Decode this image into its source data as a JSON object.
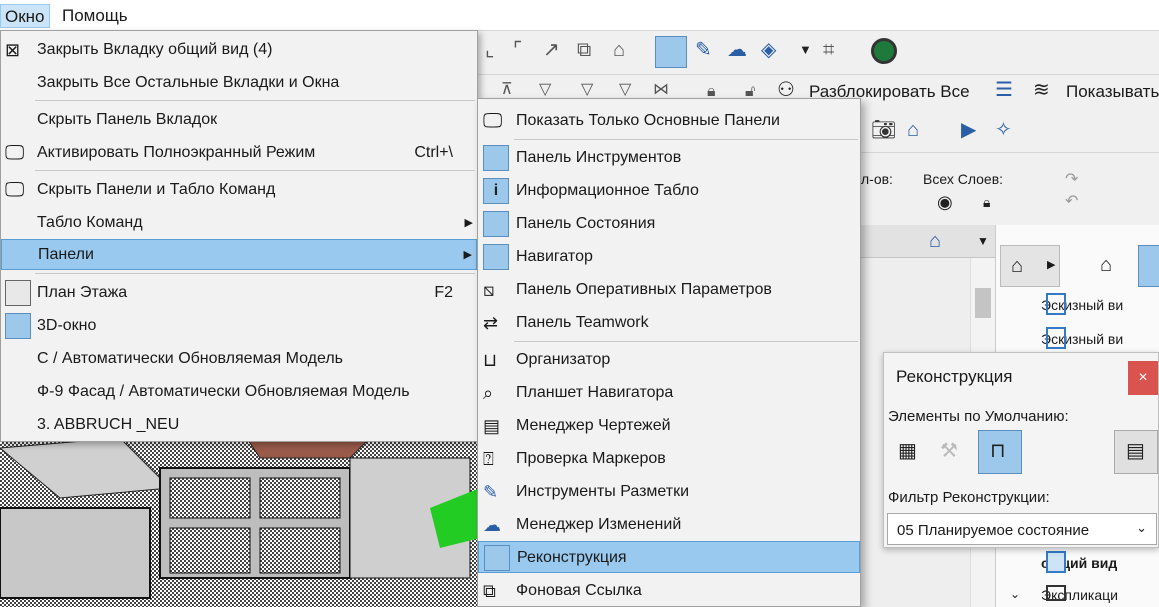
{
  "menubar": {
    "window_label": "Окно",
    "help_label": "Помощь"
  },
  "toolbar": {
    "unlock_all_label": "Разблокировать Все",
    "show_label": "Показывать",
    "layers_partial_label": "л-ов:",
    "all_layers_label": "Всех Слоев:"
  },
  "menu1": {
    "items": [
      {
        "label": "Закрыть Вкладку общий вид (4)",
        "icon": "close-tab-icon"
      },
      {
        "label": "Закрыть Все Остальные Вкладки и Окна"
      },
      {
        "label": "Скрыть Панель Вкладок"
      },
      {
        "label": "Активировать Полноэкранный Режим",
        "shortcut": "Ctrl+\\",
        "icon": "fullscreen-icon"
      },
      {
        "label": "Скрыть Панели и Табло Команд",
        "icon": "hide-panels-icon"
      },
      {
        "label": "Табло Команд",
        "submenu": true
      },
      {
        "label": "Панели",
        "submenu": true,
        "highlighted": true
      },
      {
        "label": "План Этажа",
        "shortcut": "F2",
        "icon": "floor-plan-icon"
      },
      {
        "label": "3D-окно",
        "icon": "3d-window-icon"
      },
      {
        "label": "С  / Автоматически Обновляемая Модель"
      },
      {
        "label": "Ф-9 Фасад / Автоматически Обновляемая Модель"
      },
      {
        "label": "3. ABBRUCH _NEU"
      }
    ]
  },
  "menu2": {
    "items": [
      {
        "label": "Показать Только Основные Панели",
        "icon": "basic-panels-icon"
      },
      {
        "label": "Панель Инструментов",
        "icon": "toolbox-icon",
        "checked": true
      },
      {
        "label": "Информационное Табло",
        "icon": "info-box-icon",
        "checked": true
      },
      {
        "label": "Панель Состояния",
        "icon": "status-bar-icon",
        "checked": true
      },
      {
        "label": "Навигатор",
        "icon": "navigator-icon",
        "checked": true
      },
      {
        "label": "Панель Оперативных Параметров",
        "icon": "quick-options-icon"
      },
      {
        "label": "Панель Teamwork",
        "icon": "teamwork-icon"
      },
      {
        "label": "Организатор",
        "icon": "organizer-icon"
      },
      {
        "label": "Планшет Навигатора",
        "icon": "navigator-preview-icon"
      },
      {
        "label": "Менеджер Чертежей",
        "icon": "drawing-manager-icon"
      },
      {
        "label": "Проверка Маркеров",
        "icon": "marker-check-icon"
      },
      {
        "label": "Инструменты Разметки",
        "icon": "markup-tools-icon"
      },
      {
        "label": "Менеджер Изменений",
        "icon": "change-manager-icon"
      },
      {
        "label": "Реконструкция",
        "icon": "renovation-icon",
        "highlighted": true,
        "checked": true
      },
      {
        "label": "Фоновая Ссылка",
        "icon": "background-reference-icon"
      }
    ]
  },
  "dialog": {
    "title": "Реконструкция",
    "close_label": "×",
    "defaults_label": "Элементы по Умолчанию:",
    "filter_label": "Фильтр Реконструкции:",
    "filter_value": "05 Планируемое состояние"
  },
  "right_panel": {
    "items": [
      "Эскизный ви",
      "Эскизный ви",
      "общий вид",
      "Экспликаци"
    ]
  },
  "colors": {
    "highlight": "#99c9ef",
    "menu_bg": "#f2f2f2",
    "close_red": "#d9534f"
  }
}
